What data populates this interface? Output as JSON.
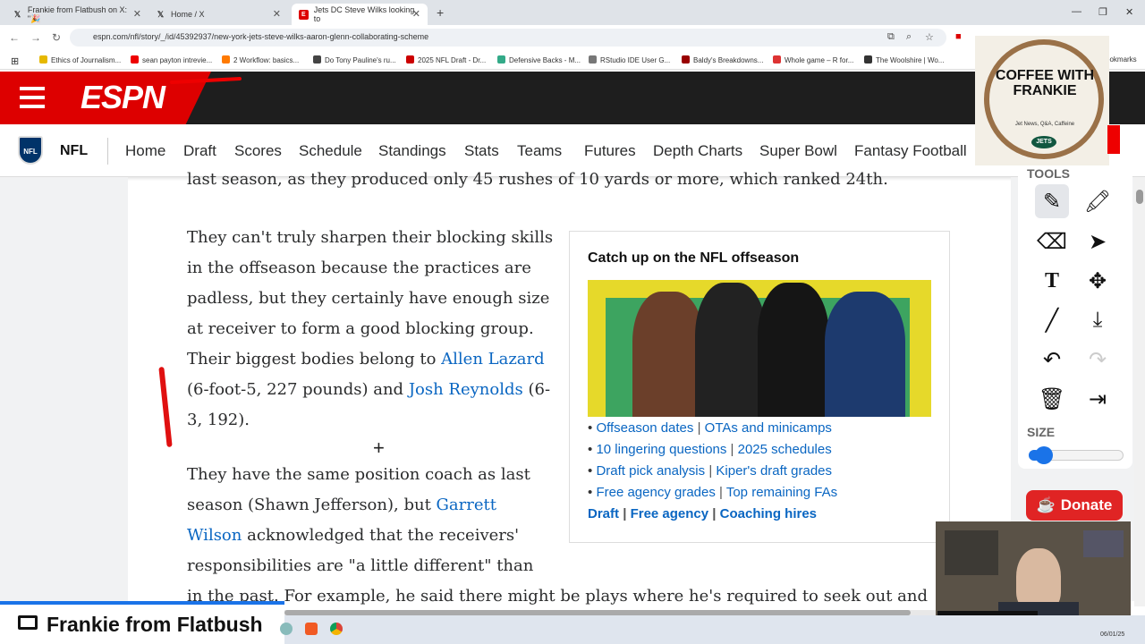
{
  "browser": {
    "tabs": [
      {
        "title": "Frankie from Flatbush on X: \"🎉",
        "favicon": "x-logo"
      },
      {
        "title": "Home / X",
        "favicon": "x-logo"
      },
      {
        "title": "Jets DC Steve Wilks looking to",
        "favicon": "espn-logo"
      }
    ],
    "new_tab": "+",
    "url": "espn.com/nfl/story/_/id/45392937/new-york-jets-steve-wilks-aaron-glenn-collaborating-scheme",
    "bookmarks": [
      {
        "label": "Ethics of Journalism...",
        "color": "#e6b800"
      },
      {
        "label": "sean payton intrevie...",
        "color": "#e00"
      },
      {
        "label": "2  Workflow: basics...",
        "color": "#ff7a00"
      },
      {
        "label": "Do Tony Pauline's ru...",
        "color": "#444"
      },
      {
        "label": "2025 NFL Draft - Dr...",
        "color": "#c00"
      },
      {
        "label": "Defensive Backs - M...",
        "color": "#3a8"
      },
      {
        "label": "RStudio IDE User G...",
        "color": "#777"
      },
      {
        "label": "Baldy's Breakdowns...",
        "color": "#900"
      },
      {
        "label": "Whole game – R for...",
        "color": "#d33"
      },
      {
        "label": "The Woolshire | Wo...",
        "color": "#333"
      },
      {
        "label": "ookmarks",
        "color": "#aaa"
      }
    ]
  },
  "espn": {
    "logo": "ESPN",
    "sport": "NFL",
    "nav": [
      "Home",
      "Draft",
      "Scores",
      "Schedule",
      "Standings",
      "Stats",
      "Teams",
      "Futures",
      "Depth Charts",
      "Super Bowl",
      "Fantasy Football"
    ]
  },
  "article": {
    "top_line": "last season, as they produced only 45 rushes of 10 yards or more, which ranked 24th.",
    "p1_pre": "They can't truly sharpen their blocking skills in the offseason because the practices are padless, but they certainly have enough size at receiver to form a good blocking group. Their biggest bodies belong to ",
    "p1_link1": "Allen Lazard",
    "p1_mid": " (6-foot-5, 227 pounds) and ",
    "p1_link2": "Josh Reynolds",
    "p1_post": " (6-3, 192).",
    "p2_pre": "They have the same position coach as last season (Shawn Jefferson), but ",
    "p2_link": "Garrett Wilson",
    "p2_post": " acknowledged that the receivers' responsibilities are \"a little different\" than",
    "p3": "in the past. For example, he said there might be plays where he's required to seek out and"
  },
  "sidebar": {
    "title": "Catch up on the NFL offseason",
    "links": [
      [
        "Offseason dates",
        "OTAs and minicamps"
      ],
      [
        "10 lingering questions",
        "2025 schedules"
      ],
      [
        "Draft pick analysis",
        "Kiper's draft grades"
      ],
      [
        "Free agency grades",
        "Top remaining FAs"
      ]
    ],
    "bottom_links": [
      "Draft",
      "Free agency",
      "Coaching hires"
    ]
  },
  "tools": {
    "label": "TOOLS",
    "size_label": "SIZE",
    "size_value": 0.12,
    "donate": "Donate"
  },
  "overlay": {
    "logo_title": "COFFEE WITH FRANKIE",
    "logo_sub": "Jet News, Q&A, Caffeine",
    "logo_badge": "JETS",
    "stream_name": "Frankie from Flatbush",
    "cam_label": "Frankie from Flatbush",
    "date": "06/01/25"
  }
}
